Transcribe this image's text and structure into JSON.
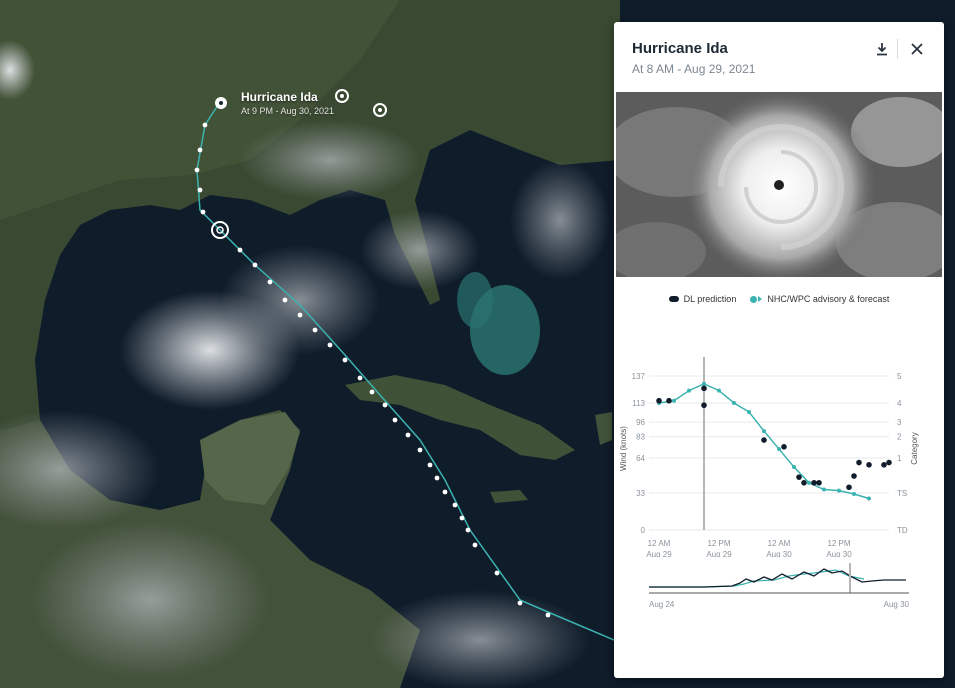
{
  "map": {
    "storm_label": {
      "title": "Hurricane Ida",
      "subtitle": "At 9 PM - Aug 30, 2021"
    },
    "icons": [
      "hurricane-icon",
      "hurricane-icon",
      "hurricane-icon",
      "hurricane-icon"
    ],
    "colors": {
      "track": "#3bb3b0",
      "points": "#ffffff"
    }
  },
  "panel": {
    "title": "Hurricane Ida",
    "subtitle": "At 8 AM - Aug 29, 2021",
    "download_icon": "download-icon",
    "close_icon": "close-icon",
    "legend": {
      "dl": "DL prediction",
      "nhc": "NHC/WPC advisory & forecast"
    }
  },
  "chart_data": {
    "type": "line",
    "ylabel": "Wind (knots)",
    "ylabel_right": "Category",
    "ylim": [
      0,
      145
    ],
    "y_ticks": [
      "0",
      "33",
      "64",
      "83",
      "96",
      "113",
      "137"
    ],
    "category_ticks": [
      {
        "label": "TD",
        "y": 0
      },
      {
        "label": "TS",
        "y": 33
      },
      {
        "label": "1",
        "y": 64
      },
      {
        "label": "2",
        "y": 83
      },
      {
        "label": "3",
        "y": 96
      },
      {
        "label": "4",
        "y": 113
      },
      {
        "label": "5",
        "y": 137
      }
    ],
    "x_ticks": [
      {
        "label": [
          "12 AM",
          "Aug 29"
        ],
        "x": 0
      },
      {
        "label": [
          "12 PM",
          "Aug 29"
        ],
        "x": 12
      },
      {
        "label": [
          "12 AM",
          "Aug 30"
        ],
        "x": 24
      },
      {
        "label": [
          "12 PM",
          "Aug 30"
        ],
        "x": 36
      }
    ],
    "xlim": [
      -2,
      46
    ],
    "current_x": 9,
    "series": [
      {
        "name": "DL prediction",
        "color": "#111d2b",
        "points": [
          [
            0,
            115
          ],
          [
            2,
            115
          ],
          [
            9,
            126
          ],
          [
            9,
            111
          ],
          [
            21,
            80
          ],
          [
            25,
            74
          ],
          [
            28,
            47
          ],
          [
            29,
            42
          ],
          [
            31,
            42
          ],
          [
            32,
            42
          ],
          [
            38,
            38
          ],
          [
            39,
            48
          ],
          [
            40,
            60
          ],
          [
            42,
            58
          ],
          [
            45,
            58
          ],
          [
            46,
            60
          ]
        ]
      },
      {
        "name": "NHC/WPC advisory & forecast",
        "color": "#3bb3b0",
        "points": [
          [
            0,
            113
          ],
          [
            3,
            115
          ],
          [
            6,
            124
          ],
          [
            9,
            130
          ],
          [
            12,
            124
          ],
          [
            15,
            113
          ],
          [
            18,
            105
          ],
          [
            21,
            88
          ],
          [
            24,
            72
          ],
          [
            27,
            56
          ],
          [
            30,
            42
          ],
          [
            33,
            36
          ],
          [
            36,
            35
          ],
          [
            39,
            32
          ],
          [
            42,
            28
          ]
        ]
      }
    ],
    "overview": {
      "x_labels": [
        "Aug 24",
        "Aug 30"
      ]
    }
  }
}
